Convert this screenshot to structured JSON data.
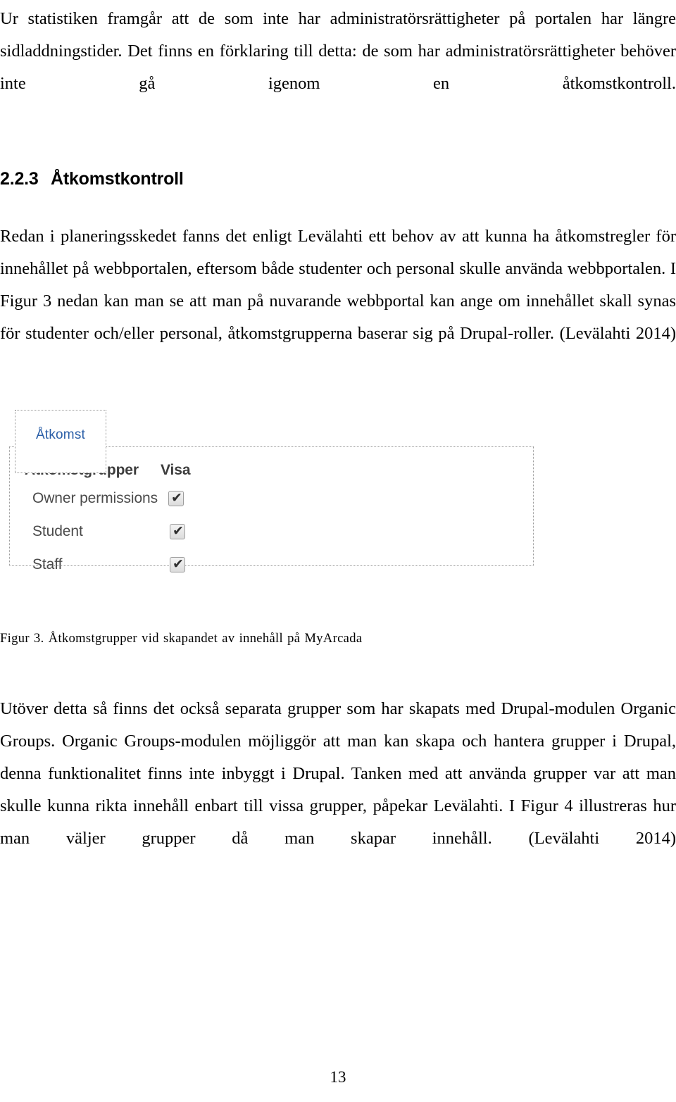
{
  "document": {
    "language": "sv",
    "page_number": "13"
  },
  "paragraphs": {
    "intro": "Ur statistiken framgår att de som inte har administratörsrättigheter på portalen har längre sidladdningstider. Det finns en förklaring till detta: de som har administratörsrättigheter behöver inte gå igenom en åtkomstkontroll.",
    "redan": "Redan i planeringsskedet fanns det enligt Levälahti ett behov av att kunna ha åtkomstregler för innehållet på webbportalen, eftersom både studenter och personal skulle använda webbportalen. I Figur 3 nedan kan man se att man på nuvarande webbportal kan ange om innehållet skall synas för studenter och/eller personal, åtkomstgrupperna baserar sig på Drupal-roller. (Levälahti 2014)",
    "utover": "Utöver detta så finns det också separata grupper som har skapats med Drupal-modulen Organic Groups. Organic Groups-modulen möjliggör att man kan skapa och hantera grupper i Drupal, denna funktionalitet finns inte inbyggt i Drupal. Tanken med att använda grupper var att man skulle kunna rikta innehåll enbart till vissa grupper, påpekar Levälahti. I Figur 4 illustreras hur man väljer grupper då man skapar innehåll. (Levälahti 2014)"
  },
  "heading": {
    "number": "2.2.3",
    "title": "Åtkomstkontroll"
  },
  "figure": {
    "caption": "Figur 3. Åtkomstgrupper vid skapandet av innehåll på MyArcada",
    "tab_label": "Åtkomst",
    "tab_color": "#2b5fa8",
    "column_headers": {
      "groups": "Åtkomstgrupper",
      "visible": "Visa"
    },
    "rows": [
      {
        "label": "Owner permissions",
        "checked": true,
        "check_glyph": "✔"
      },
      {
        "label": "Student",
        "checked": true,
        "check_glyph": "✔"
      },
      {
        "label": "Staff",
        "checked": true,
        "check_glyph": "✔"
      }
    ]
  }
}
